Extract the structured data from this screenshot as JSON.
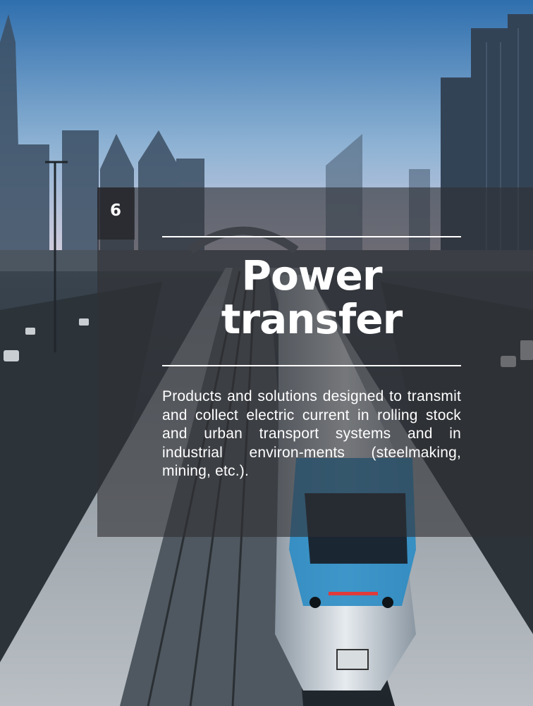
{
  "section": {
    "number": "6",
    "title_line1": "Power",
    "title_line2": "transfer",
    "description": "Products and solutions designed to transmit and collect electric current in rolling stock and urban transport systems and in industrial environ-ments (steelmaking, mining, etc.)."
  },
  "background": {
    "subject": "elevated metro train on railway viaduct with city skyline",
    "colors": {
      "sky_top": "#2f6fae",
      "sky_horizon": "#d9cfdf",
      "train_accent": "#2b8cc4"
    }
  }
}
